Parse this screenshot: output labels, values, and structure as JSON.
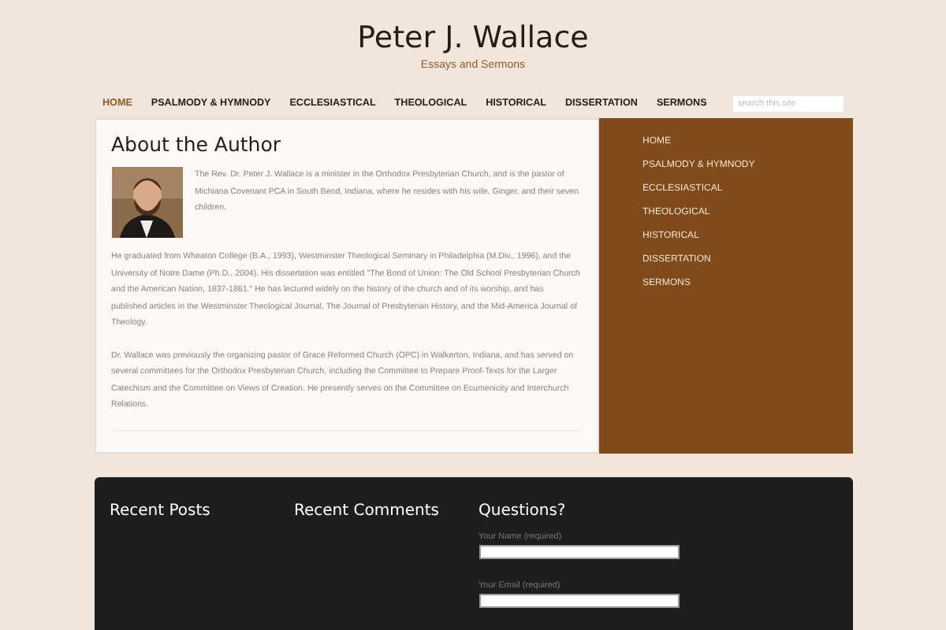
{
  "site": {
    "title": "Peter J. Wallace",
    "tagline": "Essays and Sermons"
  },
  "nav": [
    {
      "label": "HOME",
      "selected": true
    },
    {
      "label": "PSALMODY & HYMNODY",
      "selected": false
    },
    {
      "label": "ECCLESIASTICAL",
      "selected": false
    },
    {
      "label": "THEOLOGICAL",
      "selected": false
    },
    {
      "label": "HISTORICAL",
      "selected": false
    },
    {
      "label": "DISSERTATION",
      "selected": false
    },
    {
      "label": "SERMONS",
      "selected": false
    }
  ],
  "search": {
    "placeholder": "search this site"
  },
  "article": {
    "title": "About the Author",
    "paragraphs": [
      "The Rev. Dr. Peter J. Wallace is a minister in the Orthodox Presbyterian Church, and is the pastor of Michiana Covenant PCA in South Bend, Indiana, where he resides with his wife, Ginger, and their seven children.",
      "He graduated from Wheaton College (B.A., 1993), Westminster Theological Seminary in Philadelphia (M.Div., 1996), and the University of Notre Dame (Ph.D., 2004). His dissertation was entitled \"The Bond of Union: The Old School Presbyterian Church and the American Nation, 1837-1861.\" He has lectured widely on the history of the church and of its worship, and has published articles in the Westminster Theological Journal, The Journal of Presbyterian History, and the Mid-America Journal of Theology.",
      "Dr. Wallace was previously the organizing pastor of Grace Reformed Church (OPC) in Walkerton, Indiana, and has served on several committees for the Orthodox Presbyterian Church, including the Committee to Prepare Proof-Texts for the Larger Catechism and the Committee on Views of Creation. He presently serves on the Committee on Ecumenicity and Interchurch Relations."
    ]
  },
  "sidebar": {
    "items": [
      "HOME",
      "PSALMODY & HYMNODY",
      "ECCLESIASTICAL",
      "THEOLOGICAL",
      "HISTORICAL",
      "DISSERTATION",
      "SERMONS"
    ]
  },
  "footer": {
    "recent_posts": {
      "title": "Recent Posts"
    },
    "recent_comments": {
      "title": "Recent Comments"
    },
    "questions": {
      "title": "Questions?",
      "fields": [
        {
          "label": "Your Name (required)"
        },
        {
          "label": "Your Email (required)"
        }
      ]
    }
  }
}
